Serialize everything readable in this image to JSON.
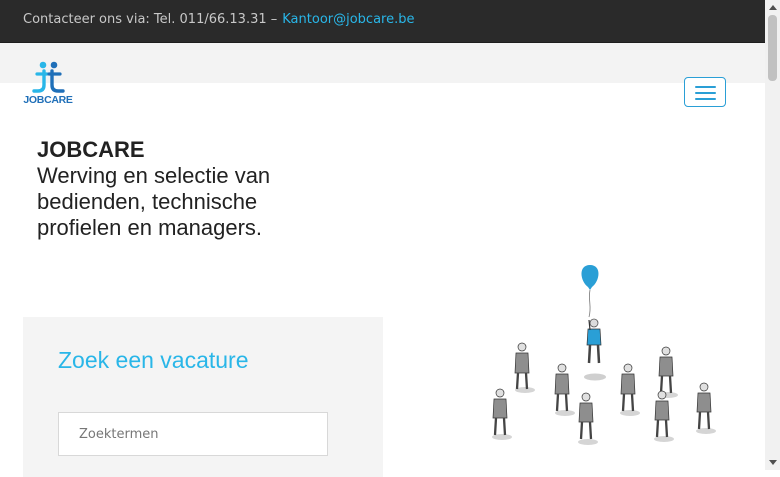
{
  "topbar": {
    "contact_text": "Contacteer ons via: Tel. 011/66.13.31 –",
    "email": "Kantoor@jobcare.be"
  },
  "header": {
    "logo_text": "JOBCARE",
    "logo_icon": "jc-figure-logo",
    "menu_icon": "hamburger-icon"
  },
  "hero": {
    "title": "JOBCARE",
    "tagline": "Werving en selectie van bedienden, technische profielen en managers."
  },
  "search": {
    "heading": "Zoek een vacature",
    "placeholder": "Zoektermen"
  },
  "illustration": {
    "description_icon": "balloon-person-crowd-illustration"
  },
  "colors": {
    "accent": "#29b6e8",
    "topbar_bg": "#2a2a2a",
    "logo_blue": "#1f6fb8",
    "balloon": "#2a9fd6"
  }
}
